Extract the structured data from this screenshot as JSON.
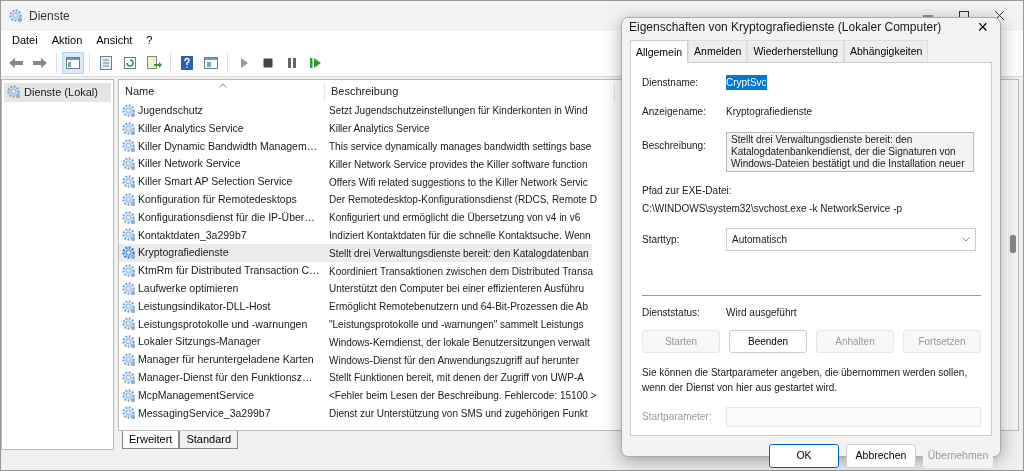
{
  "window": {
    "title": "Dienste"
  },
  "menu": [
    "Datei",
    "Aktion",
    "Ansicht",
    "?"
  ],
  "toolbar": {
    "console_tree_shown": true
  },
  "tree": [
    {
      "label": "Dienste (Lokal)",
      "selected": true
    }
  ],
  "table": {
    "columns": [
      "Name",
      "Beschreibung"
    ],
    "rows": [
      {
        "name": "Jugendschutz",
        "description": "Setzt Jugendschutzeinstellungen für Kinderkonten in Wind",
        "selected": false
      },
      {
        "name": "Killer Analytics Service",
        "description": "Killer Analytics Service",
        "selected": false
      },
      {
        "name": "Killer Dynamic Bandwidth Managem…",
        "description": "This service dynamically manages bandwidth settings base",
        "selected": false
      },
      {
        "name": "Killer Network Service",
        "description": "Killer Network Service provides the Killer software function",
        "selected": false
      },
      {
        "name": "Killer Smart AP Selection Service",
        "description": "Offers Wifi related suggestions to the Killer Network Servic",
        "selected": false
      },
      {
        "name": "Konfiguration für Remotedesktops",
        "description": "Der Remotedesktop-Konfigurationsdienst (RDCS, Remote D",
        "selected": false
      },
      {
        "name": "Konfigurationsdienst für die IP-Über…",
        "description": "Konfiguriert und ermöglicht die Übersetzung von v4 in v6",
        "selected": false
      },
      {
        "name": "Kontaktdaten_3a299b7",
        "description": "Indiziert Kontaktdaten für die schnelle Kontaktsuche. Wenn",
        "selected": false
      },
      {
        "name": "Kryptografiedienste",
        "description": "Stellt drei Verwaltungsdienste bereit: den Katalogdatenban",
        "selected": true
      },
      {
        "name": "KtmRm für Distributed Transaction C…",
        "description": "Koordiniert Transaktionen zwischen dem Distributed Transa",
        "selected": false
      },
      {
        "name": "Laufwerke optimieren",
        "description": "Unterstützt den Computer bei einer effizienteren Ausführu",
        "selected": false
      },
      {
        "name": "Leistungsindikator-DLL-Host",
        "description": "Ermöglicht Remotebenutzern und 64-Bit-Prozessen die Ab",
        "selected": false
      },
      {
        "name": "Leistungsprotokolle und -warnungen",
        "description": "\"Leistungsprotokolle und -warnungen\" sammelt Leistungs",
        "selected": false
      },
      {
        "name": "Lokaler Sitzungs-Manager",
        "description": "Windows-Kerndienst, der lokale Benutzersitzungen verwalt",
        "selected": false
      },
      {
        "name": "Manager für heruntergeladene Karten",
        "description": "Windows-Dienst für den Anwendungszugriff auf herunter",
        "selected": false
      },
      {
        "name": "Manager-Dienst für den Funktionsz…",
        "description": "Stellt Funktionen bereit, mit denen der Zugriff von UWP-A",
        "selected": false
      },
      {
        "name": "McpManagementService",
        "description": "<Fehler beim Lesen der Beschreibung. Fehlercode: 15100 >",
        "selected": false
      },
      {
        "name": "MessagingService_3a299b7",
        "description": "Dienst zur Unterstützung von SMS und zugehörigen Funkt",
        "selected": false
      }
    ]
  },
  "view_tabs": [
    {
      "label": "Erweitert",
      "selected": true
    },
    {
      "label": "Standard",
      "selected": false
    }
  ],
  "dialog": {
    "title": "Eigenschaften von Kryptografiedienste (Lokaler Computer)",
    "close": "×",
    "tabs": [
      {
        "label": "Allgemein",
        "selected": true
      },
      {
        "label": "Anmelden",
        "selected": false
      },
      {
        "label": "Wiederherstellung",
        "selected": false
      },
      {
        "label": "Abhängigkeiten",
        "selected": false
      }
    ],
    "service_name": {
      "label": "Dienstname:",
      "value": "CryptSvc"
    },
    "display_name": {
      "label": "Anzeigename:",
      "value": "Kryptografiedienste"
    },
    "description": {
      "label": "Beschreibung:",
      "value": "Stellt drei Verwaltungsdienste bereit: den Katalogdatenbankendienst, der die Signaturen von Windows-Dateien bestätigt und die Installation neuer"
    },
    "path": {
      "label": "Pfad zur EXE-Datei:",
      "value": "C:\\WINDOWS\\system32\\svchost.exe -k NetworkService -p"
    },
    "startup_type": {
      "label": "Starttyp:",
      "value": "Automatisch"
    },
    "status": {
      "label": "Dienststatus:",
      "value": "Wird ausgeführt"
    },
    "control_buttons": [
      {
        "label": "Starten",
        "disabled": true
      },
      {
        "label": "Beenden",
        "disabled": false
      },
      {
        "label": "Anhalten",
        "disabled": true
      },
      {
        "label": "Fortsetzen",
        "disabled": true
      }
    ],
    "hint": "Sie können die Startparameter angeben, die übernommen werden sollen, wenn der Dienst von hier aus gestartet wird.",
    "start_parameters": {
      "label": "Startparameter:",
      "disabled": true
    },
    "buttons": [
      {
        "label": "OK",
        "default": true,
        "disabled": false
      },
      {
        "label": "Abbrechen",
        "default": false,
        "disabled": false
      },
      {
        "label": "Übernehmen",
        "default": false,
        "disabled": true
      }
    ]
  }
}
